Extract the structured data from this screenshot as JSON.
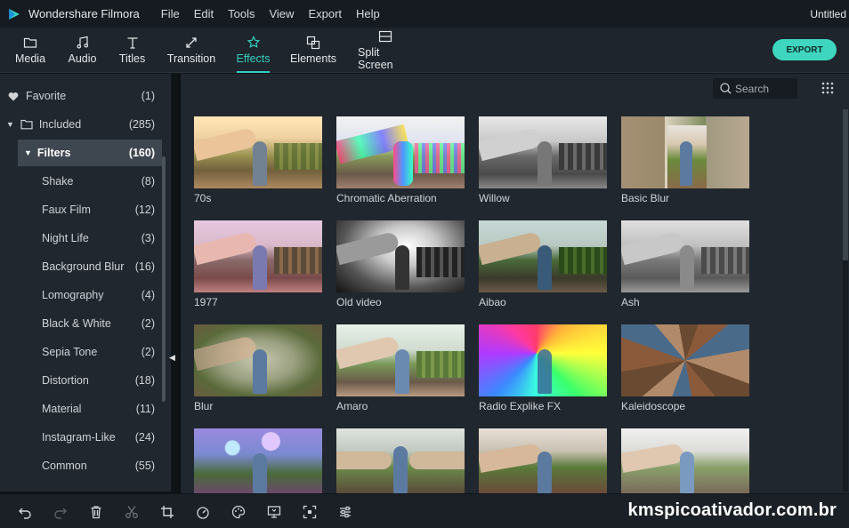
{
  "window": {
    "app_name": "Wondershare Filmora",
    "doc_title": "Untitled"
  },
  "menu": [
    "File",
    "Edit",
    "Tools",
    "View",
    "Export",
    "Help"
  ],
  "toolbar": {
    "tabs": [
      {
        "label": "Media",
        "icon": "folder-icon"
      },
      {
        "label": "Audio",
        "icon": "music-note-icon"
      },
      {
        "label": "Titles",
        "icon": "text-icon"
      },
      {
        "label": "Transition",
        "icon": "transition-icon"
      },
      {
        "label": "Effects",
        "icon": "effects-icon"
      },
      {
        "label": "Elements",
        "icon": "elements-icon"
      },
      {
        "label": "Split Screen",
        "icon": "split-screen-icon"
      }
    ],
    "active_tab": "Effects",
    "export_label": "EXPORT"
  },
  "sidebar": {
    "items": [
      {
        "label": "Favorite",
        "count": "(1)"
      },
      {
        "label": "Included",
        "count": "(285)"
      },
      {
        "label": "Filters",
        "count": "(160)"
      },
      {
        "label": "Shake",
        "count": "(8)"
      },
      {
        "label": "Faux Film",
        "count": "(12)"
      },
      {
        "label": "Night Life",
        "count": "(3)"
      },
      {
        "label": "Background Blur",
        "count": "(16)"
      },
      {
        "label": "Lomography",
        "count": "(4)"
      },
      {
        "label": "Black & White",
        "count": "(2)"
      },
      {
        "label": "Sepia Tone",
        "count": "(2)"
      },
      {
        "label": "Distortion",
        "count": "(18)"
      },
      {
        "label": "Material",
        "count": "(11)"
      },
      {
        "label": "Instagram-Like",
        "count": "(24)"
      },
      {
        "label": "Common",
        "count": "(55)"
      }
    ]
  },
  "search": {
    "placeholder": "Search"
  },
  "effects": [
    {
      "name": "70s"
    },
    {
      "name": "Chromatic Aberration"
    },
    {
      "name": "Willow"
    },
    {
      "name": "Basic Blur"
    },
    {
      "name": "1977"
    },
    {
      "name": "Old video"
    },
    {
      "name": "Aibao"
    },
    {
      "name": "Ash"
    },
    {
      "name": "Blur"
    },
    {
      "name": "Amaro"
    },
    {
      "name": "Radio Explike FX"
    },
    {
      "name": "Kaleidoscope"
    },
    {
      "name": ""
    },
    {
      "name": ""
    },
    {
      "name": ""
    },
    {
      "name": ""
    }
  ],
  "bottom_tools": [
    "undo-icon",
    "redo-icon",
    "delete-icon",
    "cut-icon",
    "crop-icon",
    "speed-icon",
    "color-icon",
    "green-screen-icon",
    "fit-icon",
    "adjust-icon"
  ],
  "watermark": "kmspicoativador.com.br",
  "colors": {
    "accent": "#34d0c0",
    "export": "#3ed6bf"
  }
}
